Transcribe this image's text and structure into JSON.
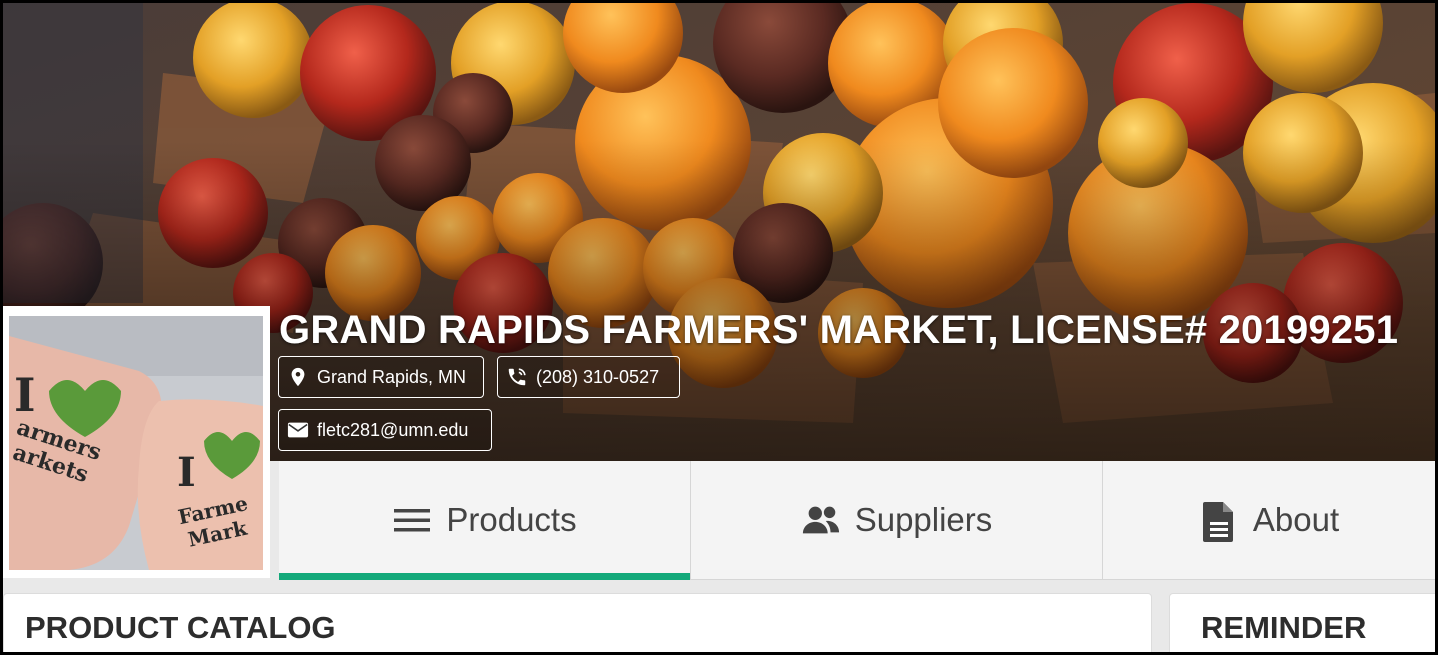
{
  "market": {
    "title": "GRAND RAPIDS FARMERS' MARKET, LICENSE# 20199251",
    "location": "Grand Rapids, MN",
    "phone": "(208) 310-0527",
    "email": "fletc281@umn.edu"
  },
  "icons": {
    "location": "map-pin-icon",
    "phone": "phone-icon",
    "email": "envelope-icon",
    "products": "hamburger-menu-icon",
    "suppliers": "users-icon",
    "about": "document-icon"
  },
  "tabs": [
    {
      "label": "Products",
      "active": true
    },
    {
      "label": "Suppliers",
      "active": false
    },
    {
      "label": "About",
      "active": false
    }
  ],
  "panels": {
    "catalog_title": "PRODUCT CATALOG",
    "reminder_title": "REMINDER"
  },
  "colors": {
    "accent": "#14a97a",
    "tab_background": "#f4f4f4",
    "heading_text": "#2d2d2d"
  }
}
